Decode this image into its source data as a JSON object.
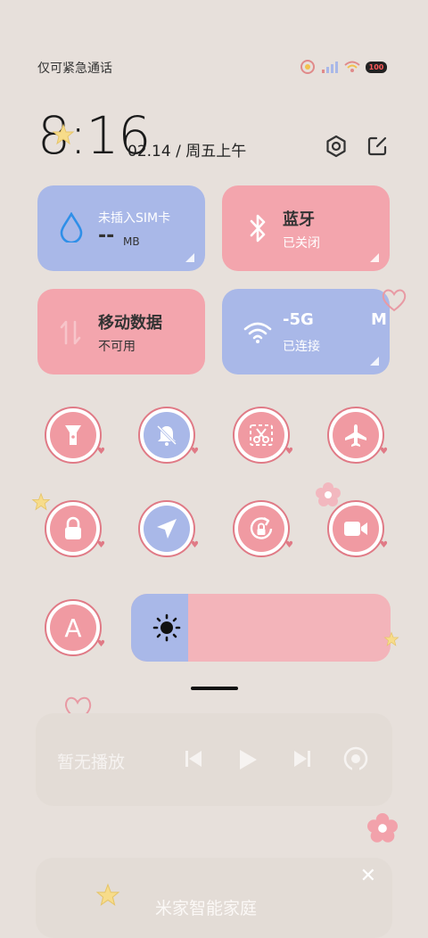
{
  "status_bar": {
    "carrier_text": "仅可紧急通话",
    "battery": "100"
  },
  "clock": {
    "time": "8:16",
    "date": "02.14 / 周五上午"
  },
  "tiles": {
    "data_usage": {
      "title": "未插入SIM卡",
      "value": "--",
      "unit": "MB"
    },
    "bluetooth": {
      "title": "蓝牙",
      "status": "已关闭"
    },
    "mobile_data": {
      "title": "移动数据",
      "status": "不可用"
    },
    "wifi": {
      "title": "-5G M",
      "status": "已连接"
    }
  },
  "toggles": [
    {
      "name": "flashlight",
      "icon": "flashlight-icon"
    },
    {
      "name": "mute",
      "icon": "bell-off-icon"
    },
    {
      "name": "screenshot",
      "icon": "scissors-icon"
    },
    {
      "name": "airplane-mode",
      "icon": "airplane-icon"
    },
    {
      "name": "lock-screen",
      "icon": "lock-icon"
    },
    {
      "name": "location",
      "icon": "location-arrow-icon"
    },
    {
      "name": "rotation-lock",
      "icon": "rotation-lock-icon"
    },
    {
      "name": "screen-record",
      "icon": "video-camera-icon"
    },
    {
      "name": "auto-brightness",
      "icon": "letter-a-icon",
      "label": "A"
    }
  ],
  "brightness": {
    "level": 0.22
  },
  "media": {
    "status_text": "暂无播放"
  },
  "smart_home": {
    "title": "米家智能家庭"
  },
  "colors": {
    "background": "#e7e0db",
    "tile_blue": "#a9b8e8",
    "tile_pink": "#f3a5ad",
    "accent": "#e07a86"
  }
}
